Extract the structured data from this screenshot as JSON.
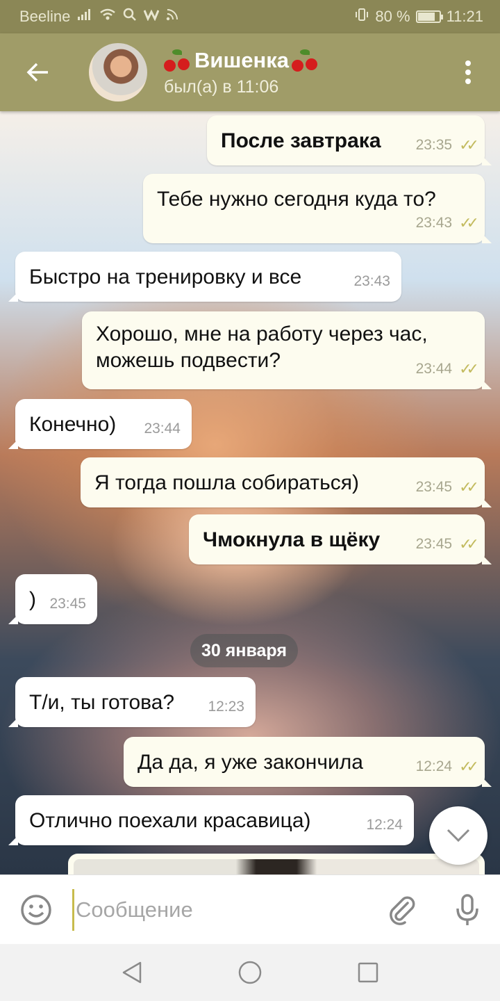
{
  "status_bar": {
    "carrier": "Beeline",
    "battery_percent": "80 %",
    "battery_level": 0.8,
    "time": "11:21"
  },
  "header": {
    "contact_name": "Вишенка",
    "last_seen": "был(а) в 11:06"
  },
  "messages": [
    {
      "dir": "out",
      "text": "После завтрака",
      "time": "23:35",
      "bold": true
    },
    {
      "dir": "out",
      "text": "Тебе нужно сегодня куда то?",
      "time": "23:43"
    },
    {
      "dir": "in",
      "text": "Быстро на тренировку и все",
      "time": "23:43"
    },
    {
      "dir": "out",
      "text": "Хорошо, мне на работу через час, можешь подвести?",
      "time": "23:44"
    },
    {
      "dir": "in",
      "text": "Конечно)",
      "time": "23:44"
    },
    {
      "dir": "out",
      "text": "Я тогда пошла собираться)",
      "time": "23:45"
    },
    {
      "dir": "out",
      "text": "Чмокнула в щёку",
      "time": "23:45",
      "bold": true
    },
    {
      "dir": "in",
      "text": ")",
      "time": "23:45"
    },
    {
      "dir": "in",
      "text": "Т/и, ты готова?",
      "time": "12:23"
    },
    {
      "dir": "out",
      "text": "Да да, я уже закончила",
      "time": "12:24"
    },
    {
      "dir": "in",
      "text": "Отлично поехали красавица)",
      "time": "12:24"
    }
  ],
  "date_separator": "30 января",
  "input": {
    "placeholder": "Сообщение",
    "value": ""
  },
  "icons": {
    "back": "arrow-left-icon",
    "menu": "more-vertical-icon",
    "emoji": "smile-icon",
    "attach": "paperclip-icon",
    "mic": "microphone-icon",
    "scroll": "chevron-down-icon",
    "nav_back": "triangle-back-icon",
    "nav_home": "circle-home-icon",
    "nav_recent": "square-recent-icon"
  },
  "colors": {
    "status_bar": "#8b8756",
    "header": "#a09c68",
    "outgoing_bubble": "#fdfcef",
    "incoming_bubble": "#ffffff",
    "read_check": "#c3bb5f"
  }
}
